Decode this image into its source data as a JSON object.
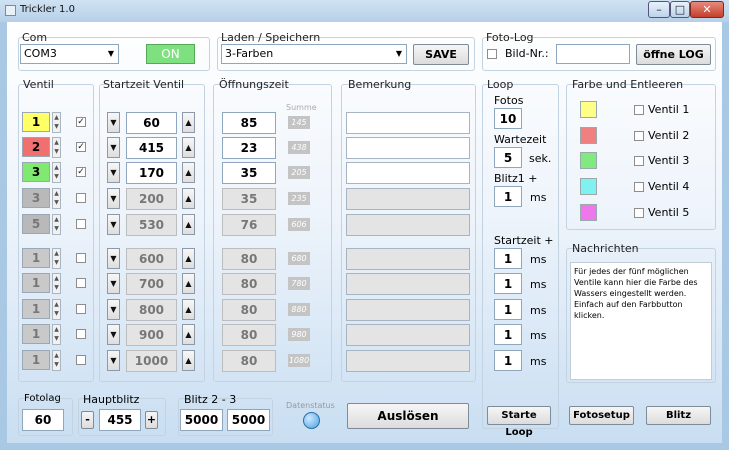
{
  "window": {
    "title": "Trickler 1.0"
  },
  "com": {
    "label": "Com",
    "port": "COM3",
    "on_label": "ON"
  },
  "laden": {
    "label": "Laden / Speichern",
    "value": "3-Farben",
    "save_label": "SAVE"
  },
  "fotolog": {
    "label": "Foto-Log",
    "bild_label": "Bild-Nr.:",
    "bild_value": "",
    "open_label": "öffne LOG"
  },
  "headers": {
    "ventil": "Ventil",
    "startzeit": "Startzeit Ventil",
    "oeffnung": "Öffnungszeit",
    "summe": "Summe",
    "bemerkung": "Bemerkung"
  },
  "rows": [
    {
      "n": "1",
      "color": "#ffff66",
      "checked": true,
      "start": "60",
      "open": "85",
      "sum": "145",
      "active": true
    },
    {
      "n": "2",
      "color": "#f07070",
      "checked": true,
      "start": "415",
      "open": "23",
      "sum": "438",
      "active": true
    },
    {
      "n": "3",
      "color": "#7fea6f",
      "checked": true,
      "start": "170",
      "open": "35",
      "sum": "205",
      "active": true
    },
    {
      "n": "3",
      "color": "#b9b9b9",
      "checked": false,
      "start": "200",
      "open": "35",
      "sum": "235",
      "active": false
    },
    {
      "n": "5",
      "color": "#b9b9b9",
      "checked": false,
      "start": "530",
      "open": "76",
      "sum": "606",
      "active": false
    },
    {
      "n": "1",
      "color": "#c9c9c9",
      "checked": false,
      "start": "600",
      "open": "80",
      "sum": "680",
      "active": false
    },
    {
      "n": "1",
      "color": "#c9c9c9",
      "checked": false,
      "start": "700",
      "open": "80",
      "sum": "780",
      "active": false
    },
    {
      "n": "1",
      "color": "#c9c9c9",
      "checked": false,
      "start": "800",
      "open": "80",
      "sum": "880",
      "active": false
    },
    {
      "n": "1",
      "color": "#c9c9c9",
      "checked": false,
      "start": "900",
      "open": "80",
      "sum": "980",
      "active": false
    },
    {
      "n": "1",
      "color": "#c9c9c9",
      "checked": false,
      "start": "1000",
      "open": "80",
      "sum": "1080",
      "active": false
    }
  ],
  "loop": {
    "label": "Loop",
    "fotos_label": "Fotos",
    "fotos": "10",
    "wartezeit_label": "Wartezeit",
    "wartezeit": "5",
    "sek": "sek.",
    "blitz1_label": "Blitz1 +",
    "blitz1": "1",
    "ms": "ms",
    "startzeit_label": "Startzeit +",
    "startzeiten": [
      "1",
      "1",
      "1",
      "1",
      "1"
    ],
    "start_button": "Starte Loop"
  },
  "farbe": {
    "label": "Farbe und Entleeren",
    "items": [
      {
        "color": "#ffff88",
        "label": "Ventil 1"
      },
      {
        "color": "#f08080",
        "label": "Ventil 2"
      },
      {
        "color": "#80ea80",
        "label": "Ventil 3"
      },
      {
        "color": "#80f0f0",
        "label": "Ventil 4"
      },
      {
        "color": "#ee77ee",
        "label": "Ventil 5"
      }
    ]
  },
  "nachrichten": {
    "label": "Nachrichten",
    "text": "Für jedes der fünf möglichen Ventile kann hier die Farbe des Wassers eingestellt werden. Einfach auf den Farbbutton klicken."
  },
  "bottom": {
    "fotolag_label": "Fotolag",
    "fotolag": "60",
    "hauptblitz_label": "Hauptblitz",
    "hauptblitz": "455",
    "minus": "-",
    "plus": "+",
    "blitz23_label": "Blitz 2 - 3",
    "blitz2": "5000",
    "blitz3": "5000",
    "datenstatus_label": "Datenstatus",
    "ausloesen": "Auslösen",
    "fotosetup": "Fotosetup",
    "blitz": "Blitz"
  }
}
